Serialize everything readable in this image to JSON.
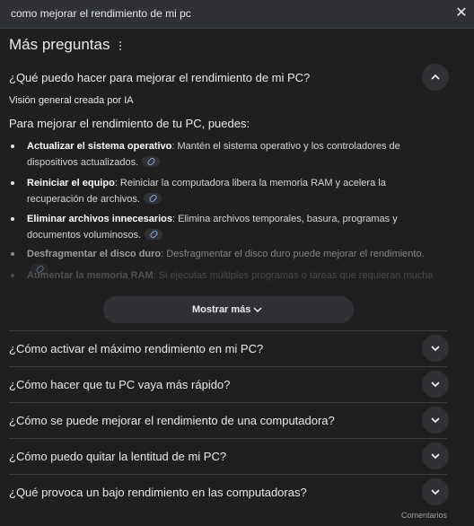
{
  "search": {
    "query": "como mejorar el rendimiento de mi pc"
  },
  "section": {
    "title": "Más preguntas"
  },
  "expanded": {
    "question": "¿Qué puedo hacer para mejorar el rendimiento de mi PC?",
    "ai_label": "Visión general creada por IA",
    "intro": "Para mejorar el rendimiento de tu PC, puedes:",
    "bullets": [
      {
        "bold": "Actualizar el sistema operativo",
        "text": ": Mantén el sistema operativo y los controladores de dispositivos actualizados."
      },
      {
        "bold": "Reiniciar el equipo",
        "text": ": Reiniciar la computadora libera la memoria RAM y acelera la recuperación de archivos."
      },
      {
        "bold": "Eliminar archivos innecesarios",
        "text": ": Elimina archivos temporales, basura, programas y documentos voluminosos."
      },
      {
        "bold": "Desfragmentar el disco duro",
        "text": ": Desfragmentar el disco duro puede mejorar el rendimiento."
      },
      {
        "bold": "Aumentar la memoria RAM",
        "text": ": Si ejecutas múltiples programas o tareas que requieran mucha"
      }
    ],
    "show_more": "Mostrar más"
  },
  "questions": [
    "¿Cómo activar el máximo rendimiento en mi PC?",
    "¿Cómo hacer que tu PC vaya más rápido?",
    "¿Cómo se puede mejorar el rendimiento de una computadora?",
    "¿Cómo puedo quitar la lentitud de mi PC?",
    "¿Qué provoca un bajo rendimiento en las computadoras?"
  ],
  "footer": {
    "feedback": "Comentarios"
  }
}
